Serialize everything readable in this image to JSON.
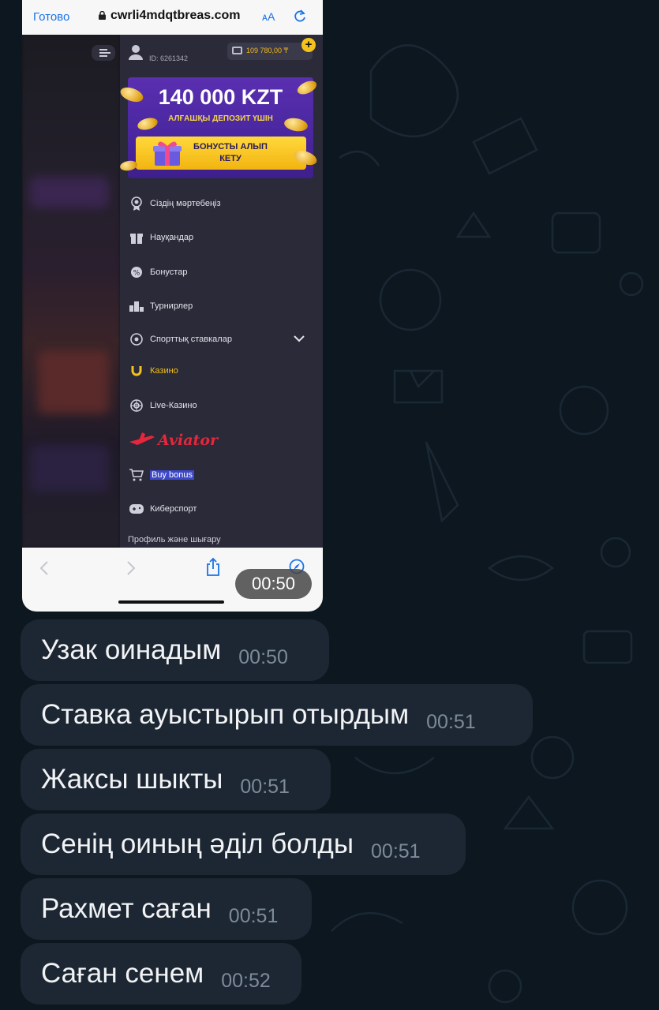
{
  "screenshot_message": {
    "browser": {
      "done_label": "Готово",
      "url": "cwrli4mdqtbreas.com",
      "text_size_label": "ᴀA"
    },
    "site": {
      "user_id": "ID: 6261342",
      "balance": "109 780,00 ₸",
      "add_funds_label": "+",
      "promo": {
        "amount": "140 000 KZT",
        "subtitle": "АЛҒАШҚЫ ДЕПОЗИТ ҮШІН",
        "button_line1": "БОНУСТЫ АЛЫП",
        "button_line2": "КЕТУ"
      },
      "menu": [
        {
          "label": "Сіздің мәртебеңіз",
          "icon": "medal-icon"
        },
        {
          "label": "Науқандар",
          "icon": "gift-icon"
        },
        {
          "label": "Бонустар",
          "icon": "bonus-chip-icon"
        },
        {
          "label": "Турнирлер",
          "icon": "podium-icon"
        },
        {
          "label": "Спорттық ставкалар",
          "icon": "soccer-ball-icon"
        },
        {
          "label": "Казино",
          "icon": "horseshoe-icon"
        },
        {
          "label": "Live-Казино",
          "icon": "roulette-icon"
        },
        {
          "label": "Aviator",
          "icon": "plane-icon"
        },
        {
          "label": "Buy bonus",
          "icon": "cart-icon"
        },
        {
          "label": "Киберспорт",
          "icon": "gamepad-icon"
        }
      ],
      "cutoff_item": "Профиль және шығару"
    },
    "time": "00:50"
  },
  "messages": [
    {
      "text": "Узак оинадым",
      "time": "00:50"
    },
    {
      "text": "Ставка ауыстырып отырдым",
      "time": "00:51"
    },
    {
      "text": "Жаксы шыкты",
      "time": "00:51"
    },
    {
      "text": "Сенің оиның әділ болды",
      "time": "00:51"
    },
    {
      "text": "Рахмет саған",
      "time": "00:51"
    },
    {
      "text": "Саған сенем",
      "time": "00:52"
    }
  ],
  "colors": {
    "chat_background": "#0d1720",
    "bubble": "#1c2733",
    "accent_gold": "#f3c11c",
    "aviator_red": "#e8263b"
  }
}
